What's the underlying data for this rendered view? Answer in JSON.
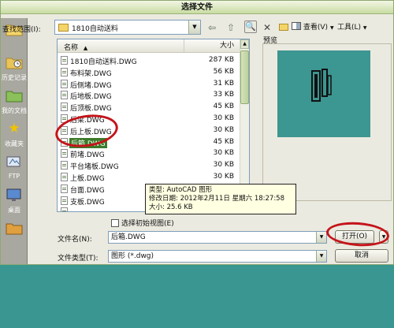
{
  "window": {
    "title": "选择文件"
  },
  "places": [
    {
      "label": "",
      "icon": "folder-icon"
    },
    {
      "label": "历史记录",
      "icon": "history-icon"
    },
    {
      "label": "我的文档",
      "icon": "documents-icon"
    },
    {
      "label": "收藏夹",
      "icon": "favorites-star-icon"
    },
    {
      "label": "FTP",
      "icon": "ftp-icon"
    },
    {
      "label": "桌面",
      "icon": "desktop-icon"
    },
    {
      "label": "",
      "icon": "buzzsaw-icon"
    }
  ],
  "toolbar": {
    "lookin_label": "查找范围(I):",
    "lookin_value": "1810自动送料",
    "view_label": "查看(V)",
    "tools_label": "工具(L)",
    "dropdown_glyph": "▼",
    "back_glyph": "⇦",
    "up_glyph": "⇧",
    "delete_glyph": "✕",
    "search_glyph": "🔍"
  },
  "filelist": {
    "col_name": "名称",
    "sort_glyph": "▲",
    "col_size": "大小",
    "rows": [
      {
        "name": "1810自动送料.DWG",
        "size": "287 KB"
      },
      {
        "name": "布料架.DWG",
        "size": "56 KB"
      },
      {
        "name": "后侧堵.DWG",
        "size": "31 KB"
      },
      {
        "name": "后地板.DWG",
        "size": "33 KB"
      },
      {
        "name": "后顶板.DWG",
        "size": "45 KB"
      },
      {
        "name": "后梁.DWG",
        "size": "30 KB"
      },
      {
        "name": "后上板.DWG",
        "size": "30 KB"
      },
      {
        "name": "后箱.DWG",
        "size": "45 KB"
      },
      {
        "name": "前堵.DWG",
        "size": "30 KB"
      },
      {
        "name": "平台堵板.DWG",
        "size": "30 KB"
      },
      {
        "name": "上板.DWG",
        "size": "30 KB"
      },
      {
        "name": "台面.DWG",
        "size": "30 KB"
      },
      {
        "name": "支板.DWG",
        "size": ""
      },
      {
        "name": "",
        "size": ""
      }
    ],
    "selected_index": 7
  },
  "preview": {
    "label": "预览"
  },
  "tooltip": {
    "type_line": "类型: AutoCAD 图形",
    "modified_line": "修改日期: 2012年2月11日 星期六 18:27:58",
    "size_line": "大小: 25.6 KB"
  },
  "initial_view_label": "选择初始视图(E)",
  "filename": {
    "label": "文件名(N):",
    "value": "后箱.DWG"
  },
  "filetype": {
    "label": "文件类型(T):",
    "value": "图形 (*.dwg)"
  },
  "buttons": {
    "open": "打开(O)",
    "cancel": "取消",
    "open_arrow": "▼"
  },
  "colors": {
    "background_teal": "#3a9690",
    "selection_green": "#3d7a2a",
    "annotation_red": "#c4141a"
  }
}
